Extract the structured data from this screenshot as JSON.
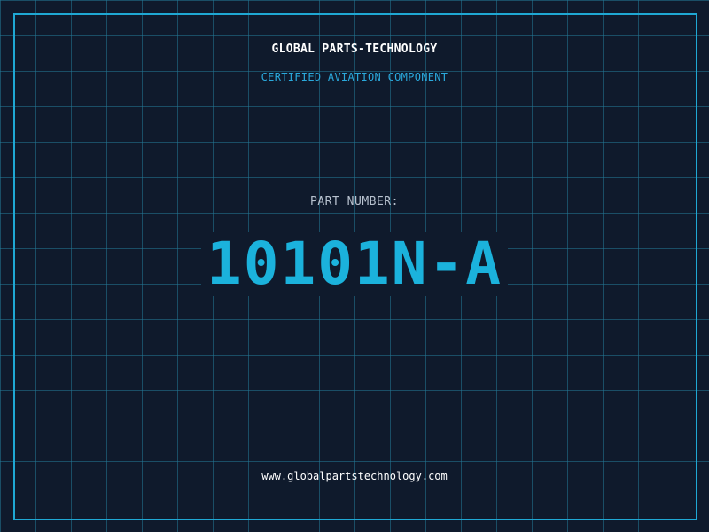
{
  "header": {
    "company": "GLOBAL PARTS-TECHNOLOGY",
    "tagline": "CERTIFIED AVIATION COMPONENT"
  },
  "part": {
    "label": "PART NUMBER:",
    "number": "10101N-A"
  },
  "footer": {
    "website": "www.globalpartstechnology.com"
  },
  "colors": {
    "background": "#0f1a2c",
    "grid": "#237896",
    "accent": "#1bb2dc",
    "frame": "#1fa8d4",
    "label": "#b8c2cf"
  }
}
